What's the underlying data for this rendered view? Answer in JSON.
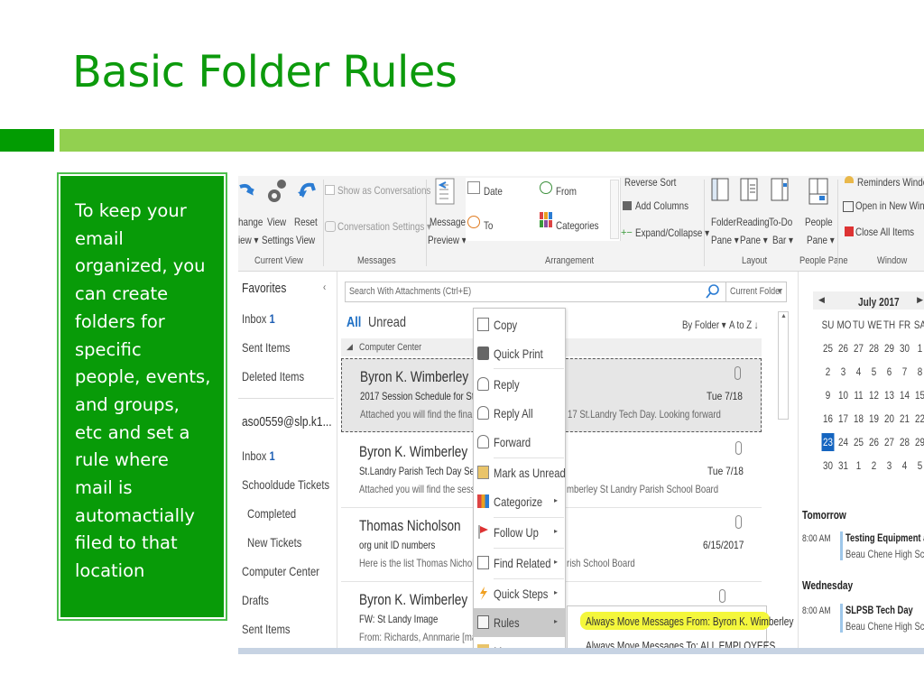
{
  "slide": {
    "title": "Basic Folder Rules",
    "body_text": "To keep your email organized, you can create folders for specific people, events, and groups, etc and set a rule where mail is automactially filed to that location",
    "colors": {
      "title": "#0c9a0c",
      "accent_dark": "#029c02",
      "accent_light": "#92d050",
      "box": "#089b08"
    }
  },
  "ribbon": {
    "current_view": {
      "change_view": "hange\niew",
      "change_view_l1": "hange",
      "change_view_l2": "iew ▾",
      "view_settings_l1": "View",
      "view_settings_l2": "Settings",
      "reset_view_l1": "Reset",
      "reset_view_l2": "View",
      "group": "Current View"
    },
    "messages": {
      "show_conversations": "Show as Conversations",
      "conversation_settings": "Conversation Settings ▾",
      "group": "Messages"
    },
    "arrangement": {
      "message_preview_l1": "Message",
      "message_preview_l2": "Preview ▾",
      "date": "Date",
      "from": "From",
      "to": "To",
      "categories": "Categories",
      "reverse_sort": "Reverse Sort",
      "add_columns": "Add Columns",
      "expand_collapse": "Expand/Collapse ▾",
      "group": "Arrangement"
    },
    "layout": {
      "folder_pane_l1": "Folder",
      "folder_pane_l2": "Pane ▾",
      "reading_pane_l1": "Reading",
      "reading_pane_l2": "Pane ▾",
      "todo_bar_l1": "To-Do",
      "todo_bar_l2": "Bar ▾",
      "group": "Layout"
    },
    "people_pane": {
      "l1": "People",
      "l2": "Pane ▾",
      "group": "People Pane"
    },
    "window": {
      "reminders": "Reminders Window",
      "open_new": "Open in New Window",
      "close_all": "Close All Items",
      "group": "Window"
    }
  },
  "folders": {
    "favorites": "Favorites",
    "fav_items": [
      {
        "label": "Inbox",
        "count": "1"
      },
      {
        "label": "Sent Items",
        "count": ""
      },
      {
        "label": "Deleted Items",
        "count": ""
      }
    ],
    "account": "aso0559@slp.k1...",
    "account_items": [
      {
        "label": "Inbox",
        "count": "1"
      },
      {
        "label": "Schooldude Tickets",
        "count": ""
      },
      {
        "label": "Completed",
        "count": ""
      },
      {
        "label": "New Tickets",
        "count": ""
      },
      {
        "label": "Computer Center",
        "count": ""
      },
      {
        "label": "Drafts",
        "count": ""
      },
      {
        "label": "Sent Items",
        "count": ""
      }
    ]
  },
  "search": {
    "placeholder": "Search With Attachments (Ctrl+E)",
    "scope": "Current Folder"
  },
  "list": {
    "filter_all": "All",
    "filter_unread": "Unread",
    "sort_by": "By Folder ▾",
    "sort_order": "A to Z ↓",
    "group_header": "Computer Center",
    "messages": [
      {
        "from": "Byron K. Wimberley",
        "subject": "2017 Session Schedule for St. Landry",
        "preview": "Attached you will find the final sched",
        "preview_tail": "17 St.Landry Tech Day.  Looking forward",
        "date": "Tue 7/18"
      },
      {
        "from": "Byron K. Wimberley",
        "subject": "St.Landry Parish Tech Day Session Sc",
        "preview": "Attached you will find the session sc",
        "preview_tail": "mberley  St Landry Parish School Board",
        "date": "Tue 7/18"
      },
      {
        "from": "Thomas Nicholson",
        "subject": "org unit ID numbers",
        "preview": "Here is the list  Thomas Nicholson  N",
        "preview_tail": "rish School Board",
        "date": "6/15/2017"
      },
      {
        "from": "Byron K. Wimberley",
        "subject": "FW: St Landy Image",
        "preview": "From: Richards, Annmarie [mailto:an",
        "preview_tail": "",
        "date": ""
      }
    ]
  },
  "context_menu": {
    "items": [
      {
        "label": "Copy",
        "icon": "copy-icon",
        "submenu": false
      },
      {
        "label": "Quick Print",
        "icon": "print-icon",
        "submenu": false
      },
      {
        "label": "Reply",
        "icon": "reply-icon",
        "submenu": false
      },
      {
        "label": "Reply All",
        "icon": "reply-all-icon",
        "submenu": false
      },
      {
        "label": "Forward",
        "icon": "forward-icon",
        "submenu": false
      },
      {
        "label": "Mark as Unread",
        "icon": "mark-unread-icon",
        "submenu": false
      },
      {
        "label": "Categorize",
        "icon": "categorize-icon",
        "submenu": true
      },
      {
        "label": "Follow Up",
        "icon": "flag-icon",
        "submenu": true
      },
      {
        "label": "Find Related",
        "icon": "find-related-icon",
        "submenu": true
      },
      {
        "label": "Quick Steps",
        "icon": "lightning-icon",
        "submenu": true
      },
      {
        "label": "Rules",
        "icon": "rules-icon",
        "submenu": true
      },
      {
        "label": "Move",
        "icon": "move-folder-icon",
        "submenu": true
      }
    ],
    "submenu": [
      "Always Move Messages From: Byron K. Wimberley",
      "Always Move Messages To: ALL EMPLOYEES"
    ]
  },
  "calendar": {
    "month": "July 2017",
    "weekdays": [
      "SU",
      "MO",
      "TU",
      "WE",
      "TH",
      "FR",
      "SA"
    ],
    "weeks": [
      [
        "25",
        "26",
        "27",
        "28",
        "29",
        "30",
        "1"
      ],
      [
        "2",
        "3",
        "4",
        "5",
        "6",
        "7",
        "8"
      ],
      [
        "9",
        "10",
        "11",
        "12",
        "13",
        "14",
        "15"
      ],
      [
        "16",
        "17",
        "18",
        "19",
        "20",
        "21",
        "22"
      ],
      [
        "23",
        "24",
        "25",
        "26",
        "27",
        "28",
        "29"
      ],
      [
        "30",
        "31",
        "1",
        "2",
        "3",
        "4",
        "5"
      ]
    ],
    "today": "23",
    "agenda": [
      {
        "day": "Tomorrow",
        "time": "8:00 AM",
        "title": "Testing Equipment at BC",
        "location": "Beau Chene High School"
      },
      {
        "day": "Wednesday",
        "time": "8:00 AM",
        "title": "SLPSB Tech Day",
        "location": "Beau Chene High School -"
      }
    ]
  }
}
